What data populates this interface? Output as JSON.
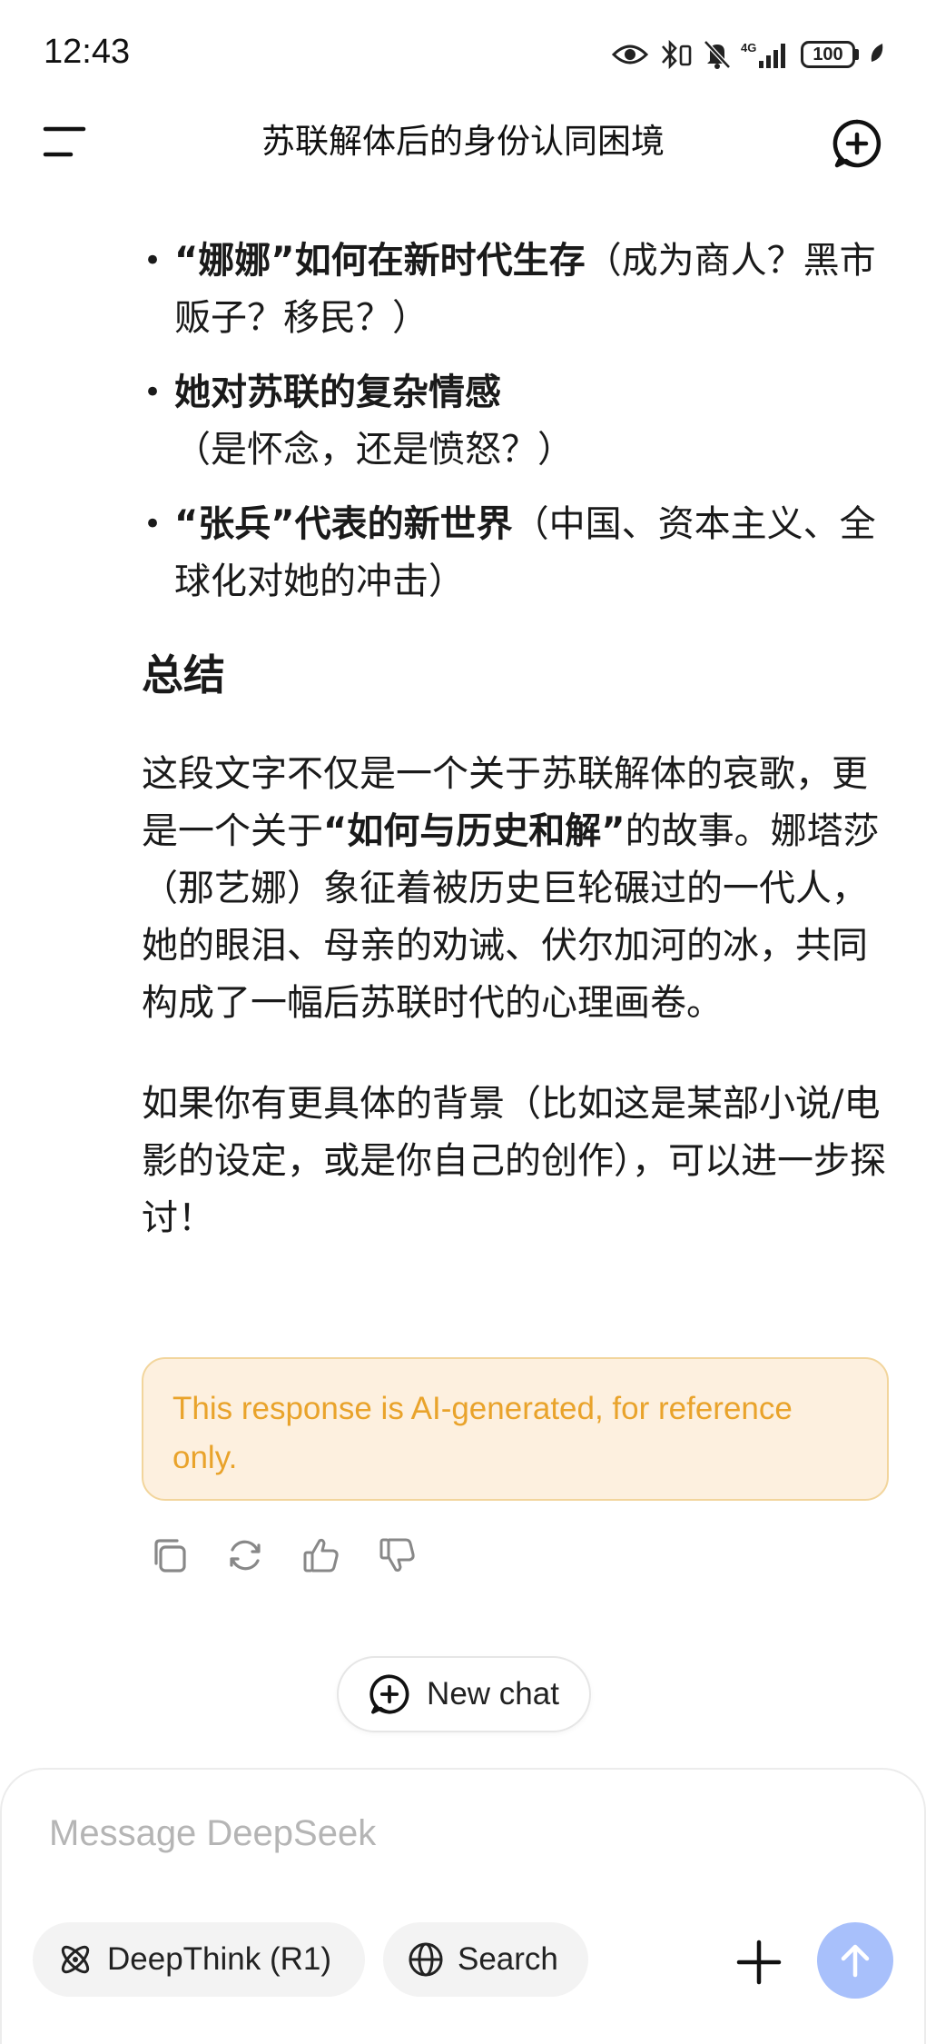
{
  "status_bar": {
    "time": "12:43",
    "battery": "100",
    "network": "4G"
  },
  "header": {
    "title": "苏联解体后的身份认同困境"
  },
  "content": {
    "bullets": [
      {
        "bold": "“娜娜”如何在新时代生存",
        "rest": "（成为商人？黑市贩子？移民？）"
      },
      {
        "bold": "她对苏联的复杂情感",
        "rest": "（是怀念，还是愤怒？）"
      },
      {
        "bold": "“张兵”代表的新世界",
        "rest": "（中国、资本主义、全球化对她的冲击）"
      }
    ],
    "summary_heading": "总结",
    "paragraph1": {
      "part1": "这段文字不仅是一个关于苏联解体的哀歌，更是一个关于",
      "bold": "“如何与历史和解”",
      "part2": "的故事。娜塔莎（那艺娜）象征着被历史巨轮碾过的一代人，她的眼泪、母亲的劝诫、伏尔加河的冰，共同构成了一幅后苏联时代的心理画卷。"
    },
    "paragraph2": "如果你有更具体的背景（比如这是某部小说/电影的设定，或是你自己的创作），可以进一步探讨！"
  },
  "disclaimer": "This response is AI-generated, for reference only.",
  "new_chat_label": "New chat",
  "composer": {
    "placeholder": "Message DeepSeek",
    "deepthink_label": "DeepThink (R1)",
    "search_label": "Search"
  },
  "colors": {
    "accent_send": "#a8c0fb",
    "disclaimer_bg": "#fdf0df",
    "disclaimer_text": "#e9a32b"
  },
  "icons": {
    "actions": [
      "copy-icon",
      "regenerate-icon",
      "thumbs-up-icon",
      "thumbs-down-icon"
    ]
  }
}
